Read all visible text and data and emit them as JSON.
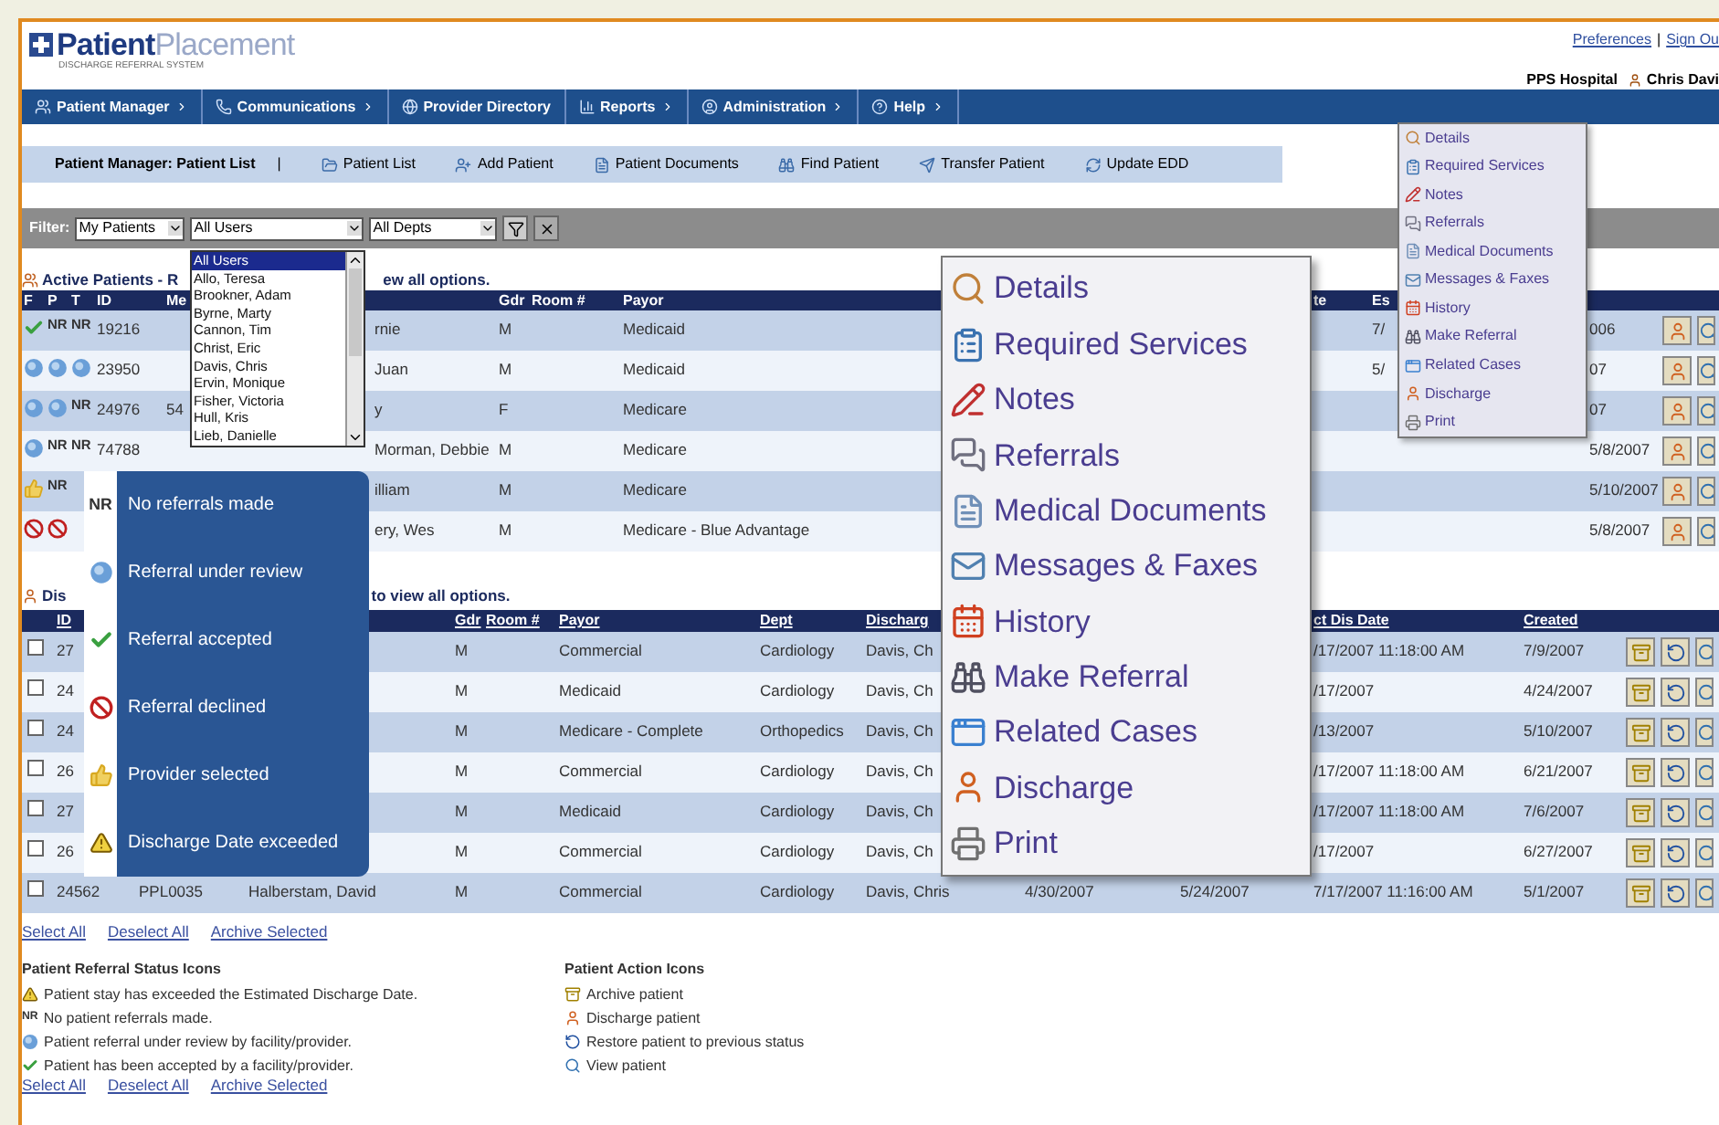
{
  "header": {
    "logo_bold": "Patient",
    "logo_light": "Placement",
    "tagline": "DISCHARGE REFERRAL SYSTEM",
    "links": [
      "Preferences",
      "Sign Ou"
    ],
    "link_separator": "|",
    "hospital": "PPS Hospital",
    "user": "Chris Davi"
  },
  "nav": [
    {
      "label": "Patient Manager",
      "menu": true
    },
    {
      "label": "Communications",
      "menu": true
    },
    {
      "label": "Provider Directory",
      "menu": false
    },
    {
      "label": "Reports",
      "menu": true
    },
    {
      "label": "Administration",
      "menu": true
    },
    {
      "label": "Help",
      "menu": true
    }
  ],
  "subnav": {
    "title": "Patient Manager: Patient List",
    "separator": "|",
    "items": [
      "Patient List",
      "Add Patient",
      "Patient Documents",
      "Find Patient",
      "Transfer Patient",
      "Update EDD"
    ]
  },
  "filter": {
    "label": "Filter:",
    "selects": [
      "My Patients",
      "All Users",
      "All Depts"
    ]
  },
  "active": {
    "title_start": "Active Patients - R",
    "title_end": "ew all options.",
    "header": {
      "f": "F",
      "p": "P",
      "t": "T",
      "id": "ID",
      "me": "Me",
      "gdr": "Gdr",
      "room": "Room #",
      "payor": "Payor",
      "te": "te",
      "es": "Es"
    },
    "rows": [
      {
        "flags": [
          {
            "kind": "accepted"
          },
          {
            "kind": "nr",
            "text": "NR"
          },
          {
            "kind": "nr",
            "text": "NR"
          }
        ],
        "id": "19216",
        "column_6": "rnie",
        "gdr": "M",
        "payor": "Medicaid",
        "es": "7/",
        "column_13": "006"
      },
      {
        "flags": [
          {
            "kind": "review"
          },
          {
            "kind": "review"
          },
          {
            "kind": "review"
          }
        ],
        "id": "23950",
        "column_6": "Juan",
        "gdr": "M",
        "payor": "Medicaid",
        "es": "5/",
        "column_13": "07"
      },
      {
        "flags": [
          {
            "kind": "review"
          },
          {
            "kind": "review"
          },
          {
            "kind": "nr",
            "text": "NR"
          }
        ],
        "id": "24976",
        "me": "54",
        "column_6": "y",
        "gdr": "F",
        "payor": "Medicare",
        "column_13": "07"
      },
      {
        "flags": [
          {
            "kind": "review"
          },
          {
            "kind": "nr",
            "text": "NR"
          },
          {
            "kind": "nr",
            "text": "NR"
          }
        ],
        "id": "74788",
        "column_6": "Morman, Debbie",
        "gdr": "M",
        "payor": "Medicare",
        "column_13": "5/8/2007"
      },
      {
        "flags": [
          {
            "kind": "thumb"
          },
          {
            "kind": "nr",
            "text": "NR"
          }
        ],
        "column_6": "illiam",
        "gdr": "M",
        "payor": "Medicare",
        "column_13": "5/10/2007"
      },
      {
        "flags": [
          {
            "kind": "declined"
          },
          {
            "kind": "declined"
          }
        ],
        "column_6": "ery, Wes",
        "gdr": "M",
        "payor": "Medicare - Blue Advantage",
        "column_13": "5/8/2007"
      }
    ]
  },
  "discharged": {
    "title_start": "Dis",
    "title_end": "to view all options.",
    "header": {
      "id": "ID",
      "gdr": "Gdr",
      "room": "Room #",
      "payor": "Payor",
      "dept": "Dept",
      "disch": "Discharg",
      "dis_date": "ct Dis Date",
      "created": "Created"
    },
    "rows": [
      {
        "checked": false,
        "id": "27",
        "gdr": "M",
        "payor": "Commercial",
        "dept": "Cardiology",
        "disch": "Davis, Ch",
        "dis_date": "/17/2007 11:18:00 AM",
        "created": "7/9/2007"
      },
      {
        "checked": false,
        "id": "24",
        "gdr": "M",
        "payor": "Medicaid",
        "dept": "Cardiology",
        "disch": "Davis, Ch",
        "dis_date": "/17/2007",
        "created": "4/24/2007"
      },
      {
        "checked": false,
        "id": "24",
        "gdr": "M",
        "payor": "Medicare - Complete",
        "dept": "Orthopedics",
        "disch": "Davis, Ch",
        "dis_date": "/13/2007",
        "created": "5/10/2007"
      },
      {
        "checked": false,
        "id": "26",
        "gdr": "M",
        "payor": "Commercial",
        "dept": "Cardiology",
        "disch": "Davis, Ch",
        "dis_date": "/17/2007 11:18:00 AM",
        "created": "6/21/2007"
      },
      {
        "checked": false,
        "id": "27",
        "gdr": "M",
        "payor": "Medicaid",
        "dept": "Cardiology",
        "disch": "Davis, Ch",
        "dis_date": "/17/2007 11:18:00 AM",
        "created": "7/6/2007"
      },
      {
        "checked": false,
        "id": "26",
        "gdr": "M",
        "payor": "Commercial",
        "dept": "Cardiology",
        "disch": "Davis, Ch",
        "dis_date": "/17/2007",
        "created": "6/27/2007"
      },
      {
        "checked": false,
        "id": "24562",
        "column_3": "PPL0035",
        "column_4": "Halberstam, David",
        "gdr": "M",
        "payor": "Commercial",
        "dept": "Cardiology",
        "disch": "Davis, Chris",
        "column_10": "4/30/2007",
        "column_11": "5/24/2007",
        "dis_date": "7/17/2007 11:16:00 AM",
        "created": "5/1/2007"
      }
    ]
  },
  "selection_links": [
    "Select All",
    "Deselect All",
    "Archive Selected"
  ],
  "status_legend": {
    "title": "Patient Referral Status Icons",
    "items": [
      {
        "kind": "warning",
        "label": "Patient stay has exceeded the Estimated Discharge Date."
      },
      {
        "kind": "nr",
        "text": "NR",
        "label": "No patient referrals made."
      },
      {
        "kind": "review",
        "label": "Patient referral under review by facility/provider."
      },
      {
        "kind": "accepted",
        "label": "Patient has been accepted by a facility/provider."
      }
    ]
  },
  "action_legend": {
    "title": "Patient Action Icons",
    "items": [
      "Archive patient",
      "Discharge patient",
      "Restore patient to previous status",
      "View patient"
    ]
  },
  "selection_links_bottom": [
    "Select All",
    "Deselect All",
    "Archive Selected"
  ],
  "user_dropdown": {
    "items": [
      {
        "label": "All Users",
        "selected": true
      },
      {
        "label": "Allo, Teresa",
        "selected": false
      },
      {
        "label": "Brookner, Adam",
        "selected": false
      },
      {
        "label": "Byrne, Marty",
        "selected": false
      },
      {
        "label": "Cannon, Tim",
        "selected": false
      },
      {
        "label": "Christ, Eric",
        "selected": false
      },
      {
        "label": "Davis, Chris",
        "selected": false
      },
      {
        "label": "Ervin, Monique",
        "selected": false
      },
      {
        "label": "Fisher, Victoria",
        "selected": false
      },
      {
        "label": "Hull, Kris",
        "selected": false
      },
      {
        "label": "Lieb, Danielle",
        "selected": false
      }
    ]
  },
  "status_callout": [
    {
      "kind": "nr",
      "text": "NR",
      "label": "No referrals made"
    },
    {
      "kind": "review",
      "label": "Referral under review"
    },
    {
      "kind": "accepted",
      "label": "Referral accepted"
    },
    {
      "kind": "declined",
      "label": "Referral declined"
    },
    {
      "kind": "thumb",
      "label": "Provider selected"
    },
    {
      "kind": "warning",
      "label": "Discharge Date exceeded"
    }
  ],
  "action_menu_large": [
    "Details",
    "Required Services",
    "Notes",
    "Referrals",
    "Medical Documents",
    "Messages & Faxes",
    "History",
    "Make Referral",
    "Related Cases",
    "Discharge",
    "Print"
  ],
  "action_menu_small": [
    "Details",
    "Required Services",
    "Notes",
    "Referrals",
    "Medical Documents",
    "Messages & Faxes",
    "History",
    "Make Referral",
    "Related Cases",
    "Discharge",
    "Print"
  ]
}
